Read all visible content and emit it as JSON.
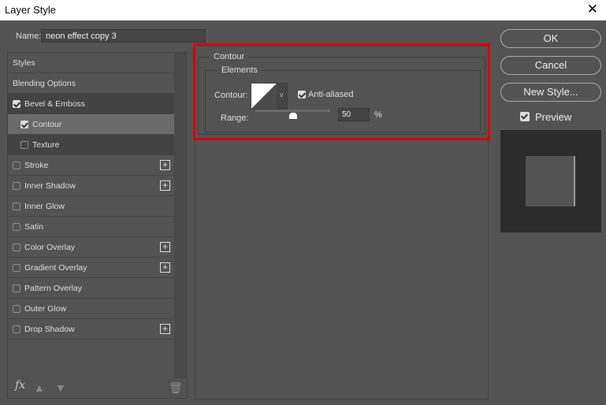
{
  "window": {
    "title": "Layer Style",
    "close": "✕"
  },
  "name": {
    "label": "Name:",
    "value": "neon effect copy 3"
  },
  "sidebar": {
    "items": [
      {
        "label": "Styles",
        "checkbox": null,
        "plus": false
      },
      {
        "label": "Blending Options",
        "checkbox": null,
        "plus": false
      },
      {
        "label": "Bevel & Emboss",
        "checkbox": true,
        "plus": false
      },
      {
        "label": "Contour",
        "checkbox": true,
        "plus": false,
        "sub": true,
        "selected": true
      },
      {
        "label": "Texture",
        "checkbox": false,
        "plus": false,
        "sub": true
      },
      {
        "label": "Stroke",
        "checkbox": false,
        "plus": true
      },
      {
        "label": "Inner Shadow",
        "checkbox": false,
        "plus": true
      },
      {
        "label": "Inner Glow",
        "checkbox": false,
        "plus": false
      },
      {
        "label": "Satin",
        "checkbox": false,
        "plus": false
      },
      {
        "label": "Color Overlay",
        "checkbox": false,
        "plus": true
      },
      {
        "label": "Gradient Overlay",
        "checkbox": false,
        "plus": true
      },
      {
        "label": "Pattern Overlay",
        "checkbox": false,
        "plus": false
      },
      {
        "label": "Outer Glow",
        "checkbox": false,
        "plus": false
      },
      {
        "label": "Drop Shadow",
        "checkbox": false,
        "plus": true
      }
    ],
    "fx": "fx"
  },
  "contour": {
    "group": "Contour",
    "elements": "Elements",
    "contour_label": "Contour:",
    "anti_aliased": "Anti-aliased",
    "anti_aliased_checked": true,
    "range_label": "Range:",
    "range_value": "50",
    "range_percent": 50,
    "unit": "%"
  },
  "buttons": {
    "ok": "OK",
    "cancel": "Cancel",
    "new_style": "New Style..."
  },
  "preview": {
    "label": "Preview",
    "checked": true
  },
  "colors": {
    "highlight": "#e00000"
  }
}
